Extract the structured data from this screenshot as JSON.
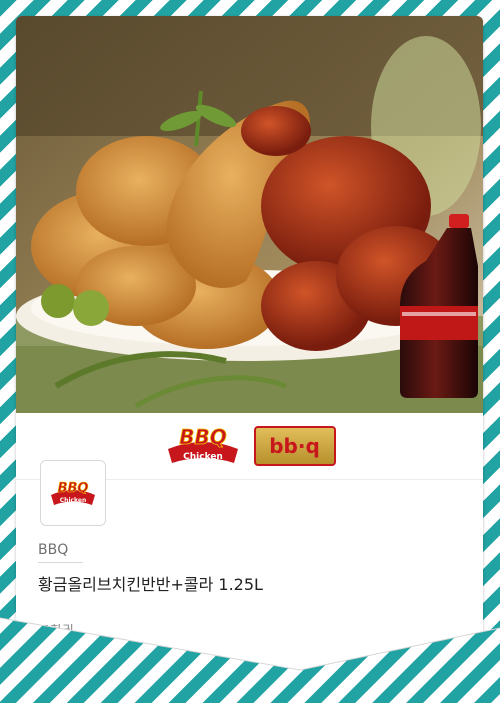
{
  "colors": {
    "stripe": "#22a3a3",
    "bbq_red": "#c8161d",
    "bbq_gold": "#c9a33a"
  },
  "brand_logos": {
    "bbq_chicken_text": "BBQ",
    "bbq_chicken_sub": "Chicken",
    "bbq_alt_text": "bb·q"
  },
  "brand": {
    "name": "BBQ"
  },
  "product": {
    "name": "황금올리브치킨반반+콜라 1.25L"
  },
  "voucher_label": "교환권"
}
